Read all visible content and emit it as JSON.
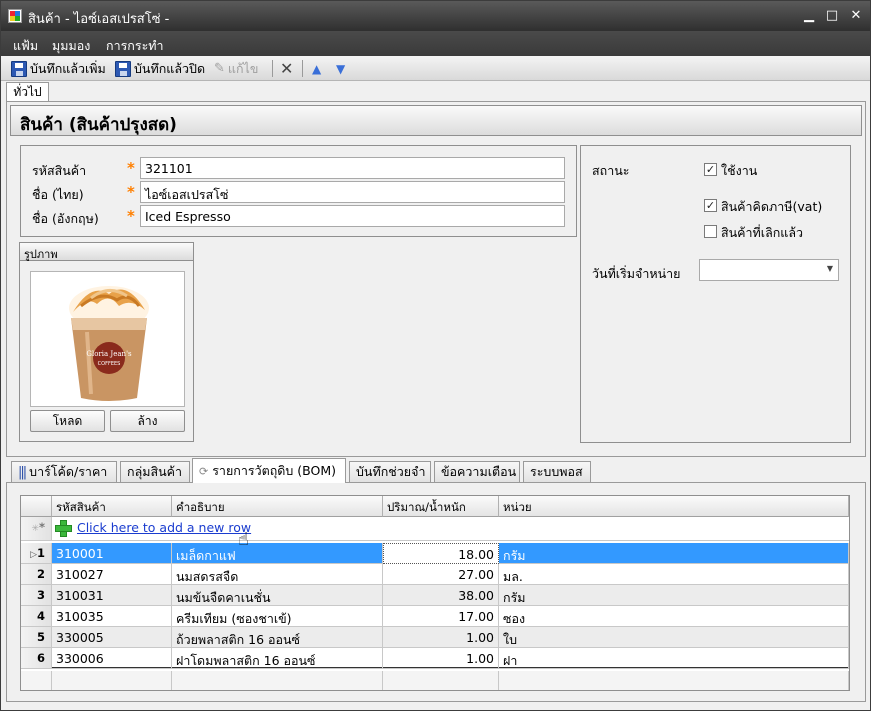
{
  "window": {
    "title": "สินค้า - ไอซ์เอสเปรสโซ่ -",
    "minimize": "▁",
    "maximize": "□",
    "close": "✕"
  },
  "menu": {
    "file": "แฟ้ม",
    "view": "มุมมอง",
    "actions": "การกระทำ"
  },
  "toolbar": {
    "save_new": "บันทึกแล้วเพิ่ม",
    "save_close": "บันทึกแล้วปิด",
    "edit": "แก้ไข"
  },
  "main_tab": "ทั่วไป",
  "header_title": "สินค้า (สินค้าปรุงสด)",
  "form": {
    "code_label": "รหัสสินค้า",
    "code_value": "321101",
    "name_th_label": "ชื่อ (ไทย)",
    "name_th_value": "ไอซ์เอสเปรสโซ่",
    "name_en_label": "ชื่อ (อังกฤษ)",
    "name_en_value": "Iced Espresso",
    "required_mark": "*"
  },
  "status": {
    "label": "สถานะ",
    "active_label": "ใช้งาน",
    "active_checked": true,
    "vat_label": "สินค้าคิดภาษี(vat)",
    "vat_checked": true,
    "discontinued_label": "สินค้าที่เลิกแล้ว",
    "discontinued_checked": false,
    "start_date_label": "วันที่เริ่มจำหน่าย",
    "start_date_value": ""
  },
  "picture": {
    "header": "รูปภาพ",
    "load_button": "โหลด",
    "clear_button": "ล้าง",
    "cup_text": "Gloria Jean's",
    "cup_subtext": "COFFEES"
  },
  "bottom_tabs": [
    {
      "label": "บาร์โค้ด/ราคา"
    },
    {
      "label": "กลุ่มสินค้า"
    },
    {
      "label": "รายการวัตถุดิบ (BOM)"
    },
    {
      "label": "บันทึกช่วยจำ"
    },
    {
      "label": "ข้อความเตือน"
    },
    {
      "label": "ระบบพอส"
    }
  ],
  "grid": {
    "columns": [
      "รหัสสินค้า",
      "คำอธิบาย",
      "ปริมาณ/น้ำหนัก",
      "หน่วย"
    ],
    "new_row_marker": "*",
    "add_row_text": "Click here to add a new row",
    "rows": [
      {
        "index": "1",
        "code": "310001",
        "desc": "เมล็ดกาแฟ",
        "qty": "18.00",
        "unit": "กรัม"
      },
      {
        "index": "2",
        "code": "310027",
        "desc": "นมสดรสจืด",
        "qty": "27.00",
        "unit": "มล."
      },
      {
        "index": "3",
        "code": "310031",
        "desc": "นมข้นจืดคาเนชั่น",
        "qty": "38.00",
        "unit": "กรัม"
      },
      {
        "index": "4",
        "code": "310035",
        "desc": "ครีมเทียม (ซองชาเข้)",
        "qty": "17.00",
        "unit": "ซอง"
      },
      {
        "index": "5",
        "code": "330005",
        "desc": "ถ้วยพลาสติก 16 ออนซ์",
        "qty": "1.00",
        "unit": "ใบ"
      },
      {
        "index": "6",
        "code": "330006",
        "desc": "ฝาโดมพลาสติก 16 ออนซ์",
        "qty": "1.00",
        "unit": "ฝา"
      }
    ]
  },
  "colors": {
    "selection": "#3399ff",
    "required": "#ff7f00",
    "link": "#1a3ccf"
  }
}
